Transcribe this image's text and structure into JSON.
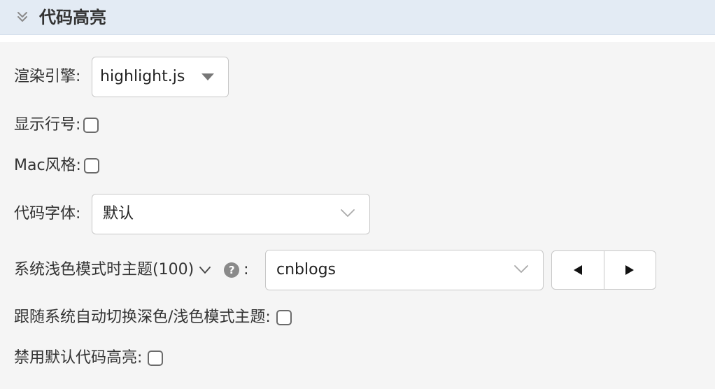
{
  "section": {
    "title": "代码高亮"
  },
  "render_engine": {
    "label": "渲染引擎:",
    "value": "highlight.js"
  },
  "line_numbers": {
    "label": "显示行号:",
    "checked": false
  },
  "mac_style": {
    "label": "Mac风格:",
    "checked": false
  },
  "code_font": {
    "label": "代码字体:",
    "value": "默认"
  },
  "light_theme": {
    "label": "系统浅色模式时主题(100)",
    "colon": ":",
    "help_glyph": "?",
    "value": "cnblogs"
  },
  "follow_system": {
    "label": "跟随系统自动切换深色/浅色模式主题:",
    "checked": false
  },
  "disable_default": {
    "label": "禁用默认代码高亮:",
    "checked": false
  },
  "icons": {
    "collapse": "double-chevron-down-icon",
    "dropdown_caret": "triangle-down-icon",
    "dropdown_chevron": "chevron-down-icon",
    "help": "question-circle-icon",
    "prev": "triangle-left-icon",
    "next": "triangle-right-icon"
  },
  "colors": {
    "header_bg": "#e3ebf4",
    "page_bg": "#f5f5f5",
    "help_icon": "#8a8a8a"
  }
}
